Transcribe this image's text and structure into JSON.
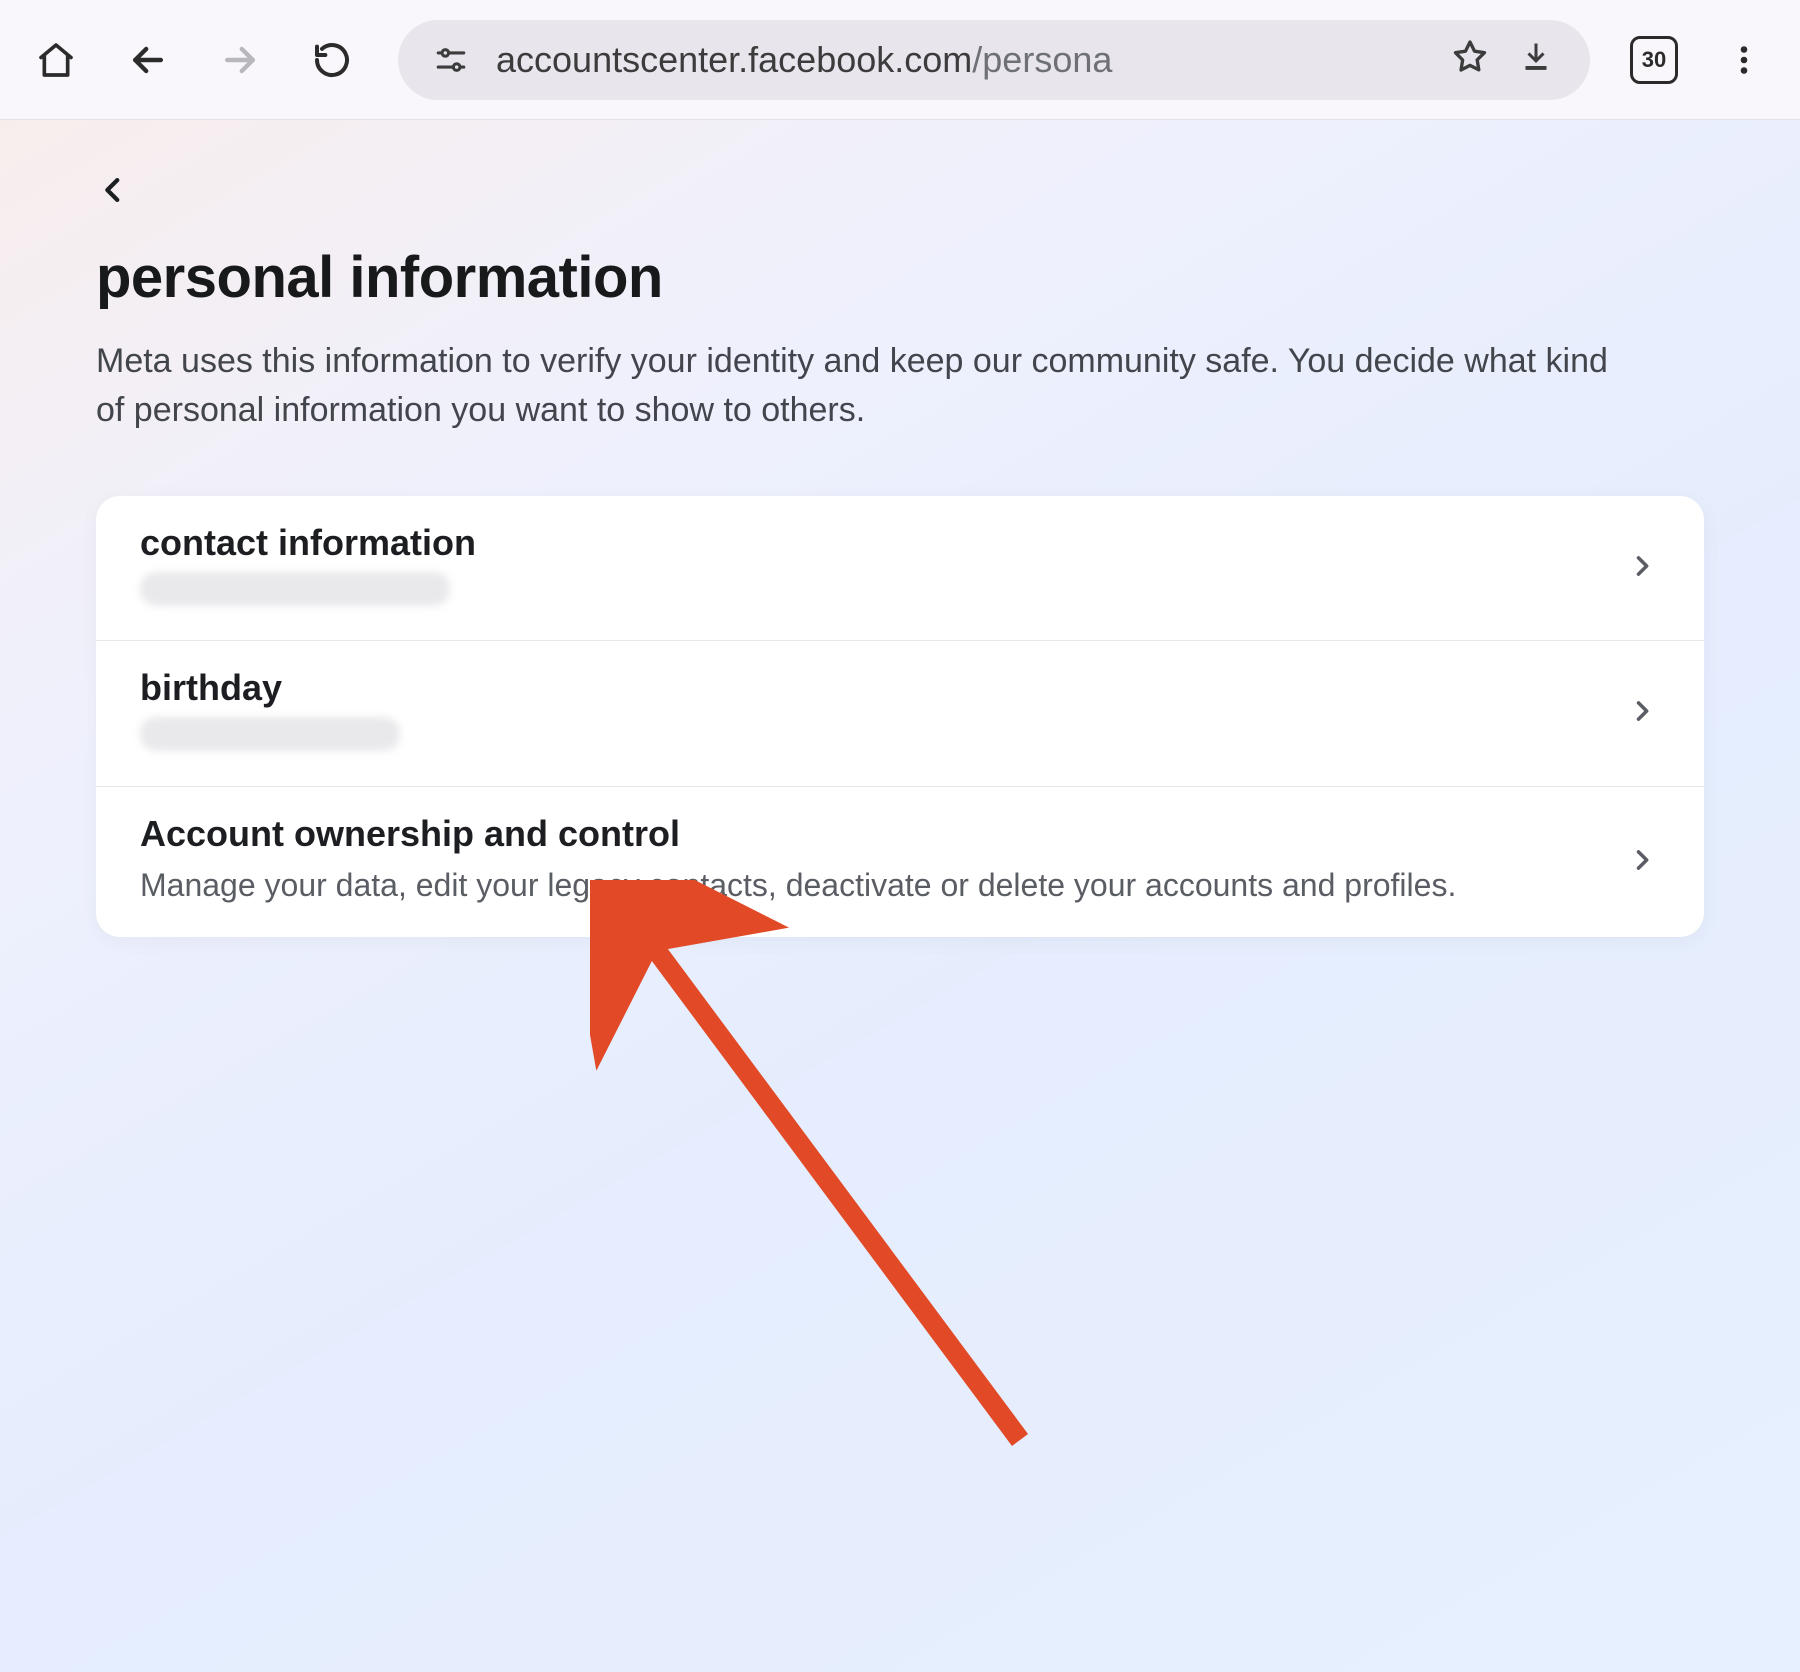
{
  "browser": {
    "url_host": "accountscenter.facebook.com",
    "url_path": "/persona",
    "tab_count": "30"
  },
  "page": {
    "title": "personal information",
    "subtitle": "Meta uses this information to verify your identity and keep our community safe. You decide what kind of personal information you want to show to others.",
    "items": [
      {
        "title": "contact information",
        "subtitle": "·",
        "redacted": true
      },
      {
        "title": "birthday",
        "subtitle": "",
        "redacted": true
      },
      {
        "title": "Account ownership and control",
        "subtitle": "Manage your data, edit your legacy contacts, deactivate or delete your accounts and profiles.",
        "redacted": false
      }
    ]
  }
}
